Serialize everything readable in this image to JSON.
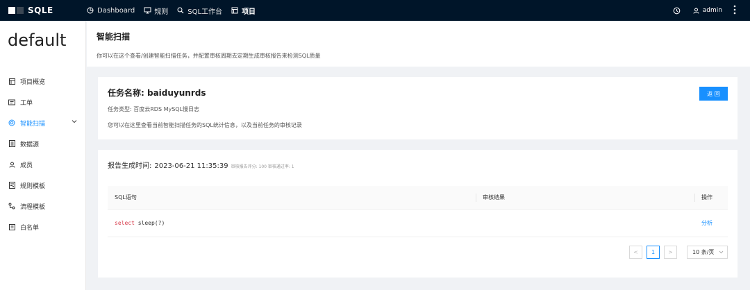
{
  "app": {
    "name": "SQLE"
  },
  "topnav": [
    {
      "label": "Dashboard",
      "icon": "pie-chart-icon"
    },
    {
      "label": "规则",
      "icon": "monitor-icon"
    },
    {
      "label": "SQL工作台",
      "icon": "search-icon"
    },
    {
      "label": "项目",
      "icon": "project-icon"
    }
  ],
  "user": {
    "name": "admin"
  },
  "sidebar": {
    "project": "default",
    "items": [
      {
        "label": "项目概览",
        "icon": "overview-icon"
      },
      {
        "label": "工单",
        "icon": "order-icon"
      },
      {
        "label": "智能扫描",
        "icon": "scan-icon",
        "active": true
      },
      {
        "label": "数据源",
        "icon": "datasource-icon"
      },
      {
        "label": "成员",
        "icon": "member-icon"
      },
      {
        "label": "规则模板",
        "icon": "rule-template-icon"
      },
      {
        "label": "流程模板",
        "icon": "workflow-icon"
      },
      {
        "label": "白名单",
        "icon": "whitelist-icon"
      }
    ]
  },
  "page": {
    "title": "智能扫描",
    "description": "你可以在这个查看/创建智能扫描任务，并配置审核周期去定期生成审核报告来检测SQL质量"
  },
  "task": {
    "title": "任务名称: baiduyunrds",
    "type": "任务类型: 百度云RDS MySQL慢日志",
    "hint": "您可以在这里查看当前智能扫描任务的SQL统计信息，以及当前任务的审核记录",
    "back_label": "返 回"
  },
  "report": {
    "label": "报告生成时间:",
    "time": "2023-06-21 11:35:39",
    "meta": "审核报告评分: 100 审核通过率: 1",
    "table": {
      "headers": [
        "SQL语句",
        "审核结果",
        "操作"
      ],
      "rows": [
        {
          "sql_keyword": "select",
          "sql_rest": " sleep(?)",
          "result": "",
          "action": "分析"
        }
      ]
    },
    "pager": {
      "prev": "<",
      "current": "1",
      "next": ">",
      "page_size": "10 条/页"
    }
  },
  "colors": {
    "topbar": "#001529",
    "accent": "#1890ff",
    "sql_keyword": "#d73a49"
  }
}
